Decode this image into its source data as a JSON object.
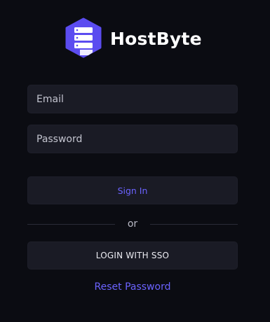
{
  "brand": {
    "name": "HostByte",
    "logo_icon": "server-rack-icon",
    "accent_color": "#5b4cf0"
  },
  "form": {
    "email_placeholder": "Email",
    "password_placeholder": "Password",
    "signin_label": "Sign In",
    "divider_text": "or",
    "sso_label": "LOGIN WITH SSO",
    "reset_label": "Reset Password"
  },
  "colors": {
    "background": "#0b0c12",
    "input_background": "#1a1b25",
    "link": "#6b63ff"
  }
}
